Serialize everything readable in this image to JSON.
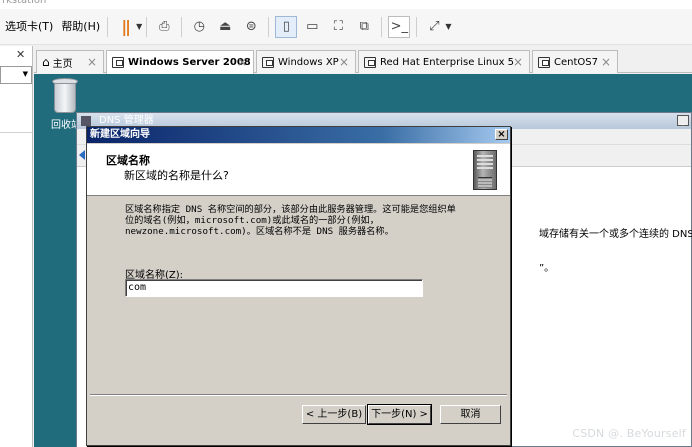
{
  "app": {
    "title_fragment": "rkstation"
  },
  "menu": {
    "tabs_label": "选项卡(T)",
    "help_label": "帮助(H)"
  },
  "tabs": [
    {
      "label": "主页",
      "icon": "home-icon"
    },
    {
      "label": "Windows Server 2008",
      "icon": "vm-icon",
      "active": true
    },
    {
      "label": "Windows XP",
      "icon": "vm-icon"
    },
    {
      "label": "Red Hat Enterprise Linux 5",
      "icon": "vm-icon"
    },
    {
      "label": "CentOS7",
      "icon": "vm-icon"
    }
  ],
  "desktop": {
    "recycle_label": "回收站"
  },
  "dns_window": {
    "title": "DNS 管理器",
    "right_text_line1": "域存储有关一个或多个连续的 DNS 域",
    "right_text_line2": "”。"
  },
  "wizard": {
    "title": "新建区域向导",
    "close_glyph": "×",
    "heading": "区域名称",
    "subheading": "新区域的名称是什么?",
    "description_lines": [
      "区域名称指定 DNS 名称空间的部分，该部分由此服务器管理。这可能是您组织单",
      "位的域名(例如，microsoft.com)或此域名的一部分(例如，",
      "newzone.microsoft.com)。区域名称不是 DNS 服务器名称。"
    ],
    "zone_name_label": "区域名称(Z):",
    "zone_name_value": "com",
    "back_button": "< 上一步(B)",
    "next_button": "下一步(N) >",
    "cancel_button": "取消"
  },
  "watermark": "CSDN @. BeYourself",
  "colors": {
    "desktop": "#206c7d",
    "wizard_title": "#0a246a",
    "wizard_face": "#d4d0c8"
  }
}
